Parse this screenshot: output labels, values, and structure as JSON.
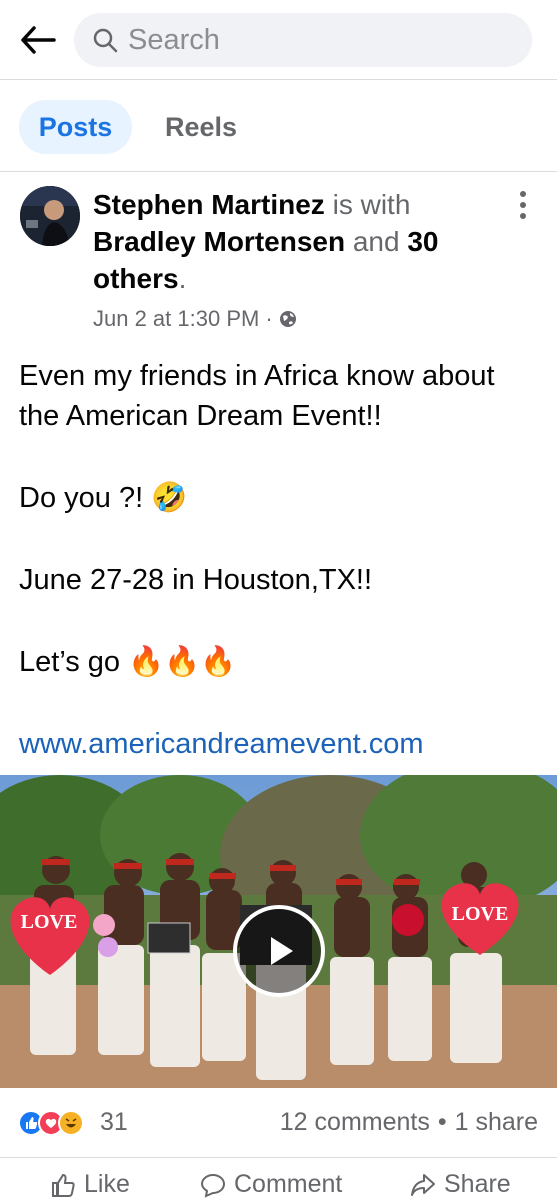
{
  "search": {
    "placeholder": "Search"
  },
  "tabs": [
    {
      "label": "Posts",
      "active": true
    },
    {
      "label": "Reels",
      "active": false
    }
  ],
  "post": {
    "author": "Stephen Martinez",
    "with_text": "is with",
    "tagged_person": "Bradley Mortensen",
    "and_text": "and",
    "others": "30 others",
    "period": ".",
    "timestamp": "Jun 2 at 1:30 PM",
    "separator": "·",
    "audience_icon": "globe-icon",
    "body": {
      "line1": "Even my friends in Africa know about the American Dream Event!!",
      "line2": "Do you ?! 🤣",
      "line3": "June 27-28 in Houston,TX!!",
      "line4": "Let’s go 🔥🔥🔥",
      "link": "www.americandreamevent.com"
    },
    "video_signs": [
      "LOVE",
      "LOVE"
    ],
    "reactions": {
      "icons": [
        "like-icon",
        "love-icon",
        "haha-icon"
      ],
      "count": "31"
    },
    "comments": "12 comments",
    "dot": "•",
    "shares": "1 share"
  },
  "actions": {
    "like": "Like",
    "comment": "Comment",
    "share": "Share"
  },
  "colors": {
    "accent": "#1b74e4",
    "tab_active_bg": "#e7f3ff",
    "link": "#1b62b8",
    "muted": "#65676b"
  }
}
